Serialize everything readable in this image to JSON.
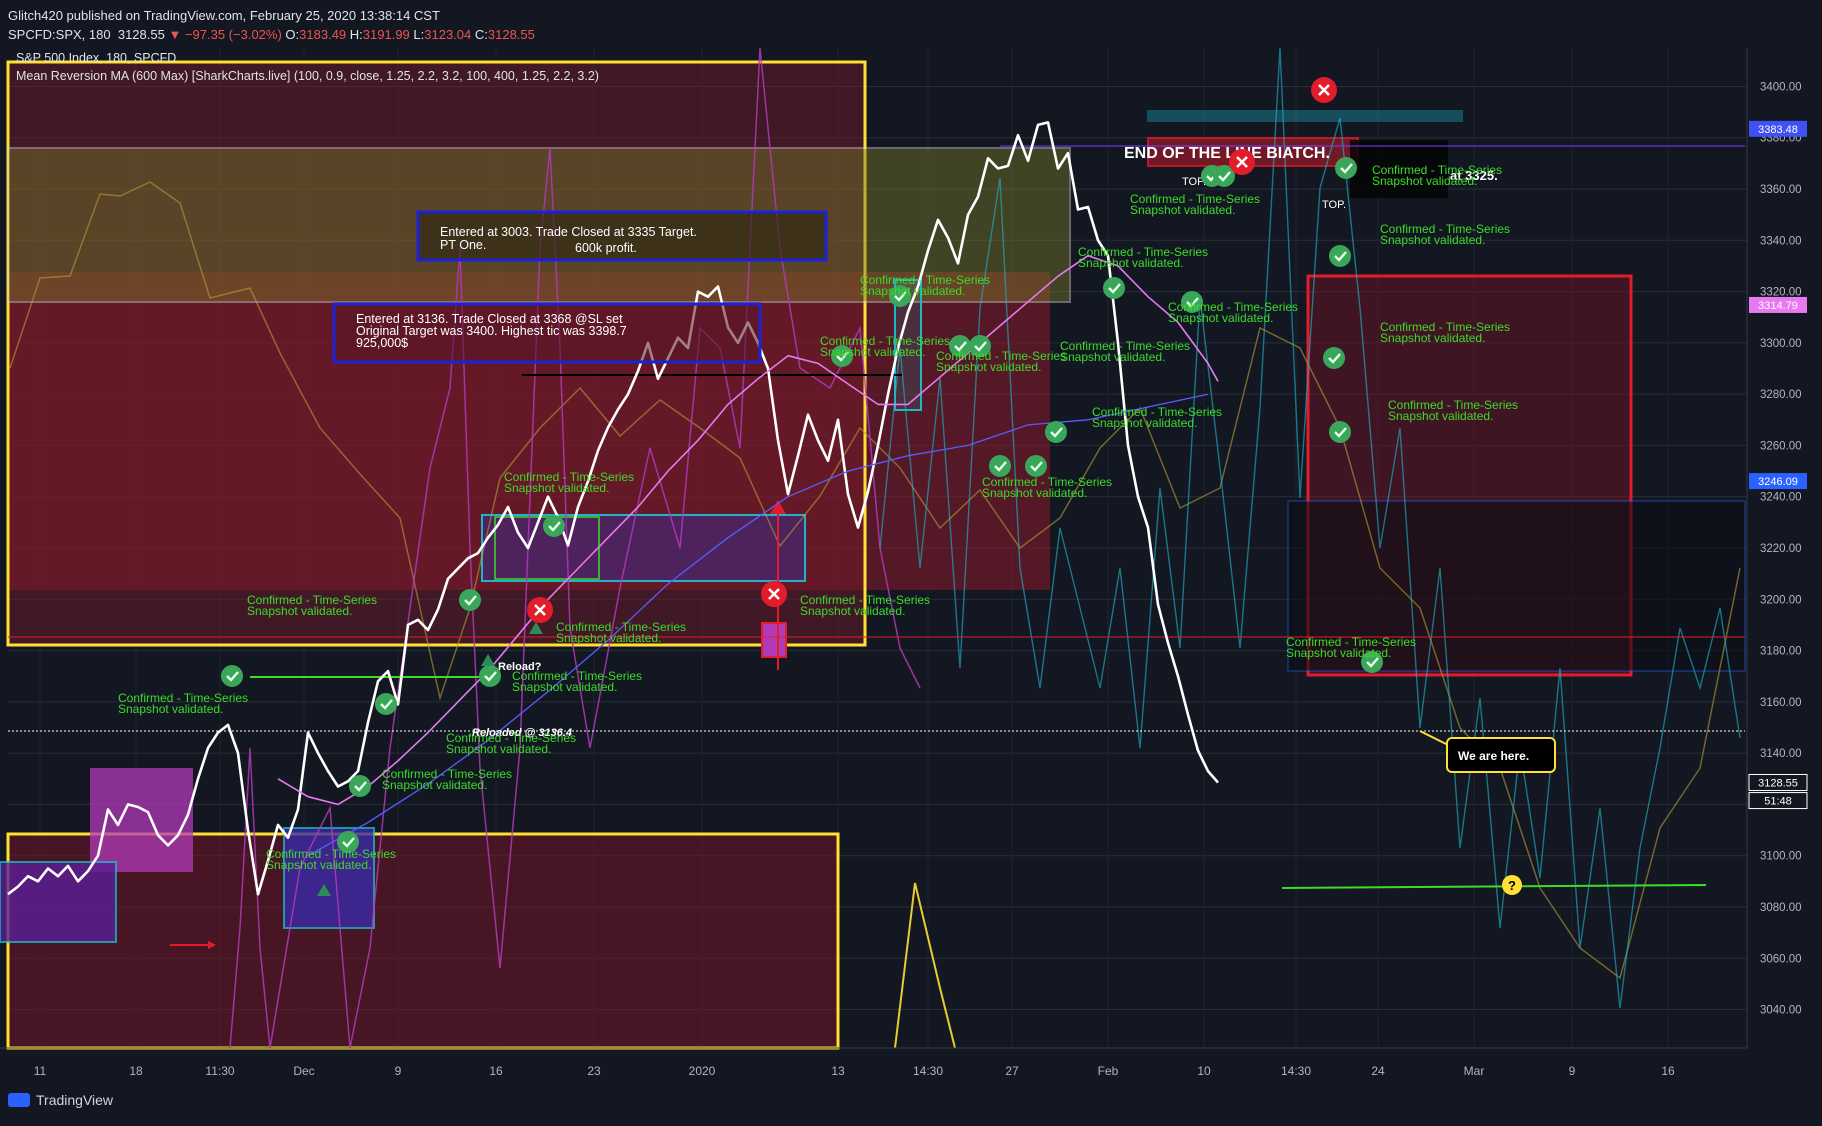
{
  "header": {
    "line1": "Glitch420 published on TradingView.com, February 25, 2020 13:38:14 CST",
    "symbol": "SPCFD:SPX, 180",
    "last": "3128.55",
    "change": "▼ −97.35 (−3.02%)",
    "o_label": "O:",
    "o": "3183.49",
    "h_label": "H:",
    "h": "3191.99",
    "l_label": "L:",
    "l": "3123.04",
    "c_label": "C:",
    "c": "3128.55"
  },
  "legend": {
    "title": "S&P 500 Index, 180, SPCFD",
    "indicator": "Mean Reversion MA (600 Max) [SharkCharts.live] (100, 0.9, close, 1.25, 2.2, 3.2, 100, 400, 1.25, 2.2, 3.2)"
  },
  "footer": {
    "brand": "TradingView"
  },
  "colors": {
    "price": "#ffffff",
    "ma": "#e879f0",
    "mavg": "#5a5cff",
    "cyan": "#1fb5c9",
    "magenta": "#b13ab8",
    "yellow": "#ffe033",
    "red": "#e11d2b",
    "green": "#3ddc2a",
    "bg": "#131722"
  },
  "chart_data": {
    "type": "line",
    "title": "S&P 500 Index, 180, SPCFD",
    "ylim": [
      3025,
      3415
    ],
    "x_ticks": [
      "11",
      "18",
      "11:30",
      "Dec",
      "9",
      "16",
      "23",
      "2020",
      "13",
      "14:30",
      "27",
      "Feb",
      "10",
      "14:30",
      "24",
      "Mar",
      "9",
      "16"
    ],
    "y_ticks": [
      "3040.00",
      "3060.00",
      "3080.00",
      "3100.00",
      "3120.00",
      "3140.00",
      "3160.00",
      "3180.00",
      "3200.00",
      "3220.00",
      "3240.00",
      "3260.00",
      "3280.00",
      "3300.00",
      "3320.00",
      "3340.00",
      "3360.00",
      "3380.00",
      "3400.00"
    ],
    "price_tags": [
      {
        "label": "3383.48",
        "value": 3383.48,
        "color": "#3f51f5"
      },
      {
        "label": "3314.79",
        "value": 3314.79,
        "color": "#e879f0"
      },
      {
        "label": "3246.09",
        "value": 3246.09,
        "color": "#2962ff"
      },
      {
        "label": "3128.55",
        "value": 3128.55,
        "color": "#ffffff"
      },
      {
        "label": "51:48",
        "value": 3121.5,
        "color": "#ffffff"
      }
    ],
    "series": [
      {
        "name": "SPX",
        "x": [
          0,
          10,
          20,
          30,
          40,
          50,
          60,
          70,
          80,
          90,
          100,
          110,
          120,
          130,
          140,
          150,
          160,
          170,
          180,
          190,
          200,
          210,
          220,
          230,
          240,
          250,
          260,
          270,
          280,
          290,
          300,
          310,
          320,
          330,
          340,
          350,
          360,
          370,
          380,
          390,
          400,
          410,
          420,
          430,
          440,
          450,
          460,
          470,
          480,
          490,
          500,
          510,
          520,
          530,
          540,
          550,
          560,
          570,
          580,
          590,
          600,
          610,
          620,
          630,
          640,
          650,
          660,
          670,
          680,
          690,
          700,
          710,
          720,
          730,
          740,
          750,
          760,
          770,
          780,
          790,
          800,
          810,
          820,
          830,
          840,
          850,
          860,
          870,
          880,
          890,
          900,
          910,
          920,
          930,
          940,
          950,
          960,
          970,
          980,
          990,
          1000,
          1010,
          1020,
          1030,
          1040,
          1050,
          1060,
          1070,
          1080,
          1090,
          1100,
          1110,
          1120,
          1130,
          1140,
          1150,
          1160,
          1170,
          1180,
          1190,
          1200,
          1210
        ],
        "values": [
          3085,
          3088,
          3092,
          3090,
          3095,
          3092,
          3096,
          3090,
          3094,
          3100,
          3118,
          3112,
          3120,
          3119,
          3117,
          3108,
          3104,
          3108,
          3116,
          3130,
          3142,
          3148,
          3151,
          3140,
          3110,
          3085,
          3098,
          3112,
          3107,
          3118,
          3148,
          3140,
          3133,
          3127,
          3129,
          3133,
          3152,
          3168,
          3172,
          3159,
          3190,
          3192,
          3188,
          3196,
          3208,
          3212,
          3216,
          3218,
          3224,
          3229,
          3236,
          3226,
          3220,
          3230,
          3240,
          3232,
          3221,
          3236,
          3246,
          3258,
          3267,
          3274,
          3280,
          3289,
          3300,
          3286,
          3294,
          3302,
          3298,
          3320,
          3318,
          3322,
          3306,
          3300,
          3308,
          3300,
          3290,
          3262,
          3241,
          3256,
          3272,
          3262,
          3254,
          3270,
          3241,
          3228,
          3242,
          3260,
          3280,
          3298,
          3312,
          3322,
          3336,
          3348,
          3341,
          3331,
          3350,
          3357,
          3372,
          3368,
          3369,
          3381,
          3371,
          3385,
          3386,
          3368,
          3374,
          3352,
          3353,
          3340,
          3334,
          3300,
          3260,
          3240,
          3228,
          3198,
          3183,
          3170,
          3155,
          3141,
          3133,
          3128.55
        ]
      },
      {
        "name": "MA",
        "x": [
          270,
          300,
          330,
          360,
          390,
          420,
          450,
          480,
          510,
          540,
          570,
          600,
          630,
          660,
          690,
          720,
          750,
          780,
          810,
          840,
          870,
          900,
          930,
          960,
          990,
          1020,
          1050,
          1080,
          1110,
          1140,
          1170,
          1200,
          1210
        ],
        "values": [
          3130,
          3123,
          3120,
          3127,
          3137,
          3148,
          3160,
          3172,
          3186,
          3200,
          3212,
          3224,
          3236,
          3250,
          3262,
          3276,
          3286,
          3295,
          3292,
          3284,
          3276,
          3276,
          3286,
          3296,
          3306,
          3316,
          3326,
          3334,
          3330,
          3318,
          3308,
          3292,
          3285
        ]
      },
      {
        "name": "MA mean",
        "x": [
          300,
          360,
          420,
          480,
          540,
          600,
          660,
          720,
          780,
          840,
          900,
          960,
          1020,
          1080,
          1140,
          1200
        ],
        "values": [
          3100,
          3113,
          3128,
          3145,
          3164,
          3184,
          3206,
          3224,
          3240,
          3250,
          3256,
          3260,
          3268,
          3270,
          3275,
          3280
        ]
      }
    ],
    "zones": [
      {
        "color": "#8a1a2a",
        "y": [
          3230,
          3332
        ]
      },
      {
        "color": "#6b1426",
        "y": [
          3191,
          3230
        ]
      }
    ],
    "annotations": {
      "box1": {
        "line1": "Entered at 3003. Trade Closed  at 3335 Target.",
        "line2": "PT One.",
        "line3": "600k profit."
      },
      "box2": {
        "line1": "Entered at 3136. Trade Closed at 3368 @SL  set",
        "line2": "Original Target was 3400. Highest tic was 3398.7",
        "line3": "925,000$"
      },
      "end_line": "END OF THE LINE BIATCH.",
      "top1": "TOP.",
      "top2": "TOP.",
      "at3325": "at 3325.",
      "reload": "Reload?",
      "reloaded": "Reloaded @ 3136.4",
      "we_are_here": "We are here.",
      "confirmed1": "Confirmed - Time-Series",
      "confirmed2": "Snapshot validated.",
      "question": "?"
    }
  }
}
